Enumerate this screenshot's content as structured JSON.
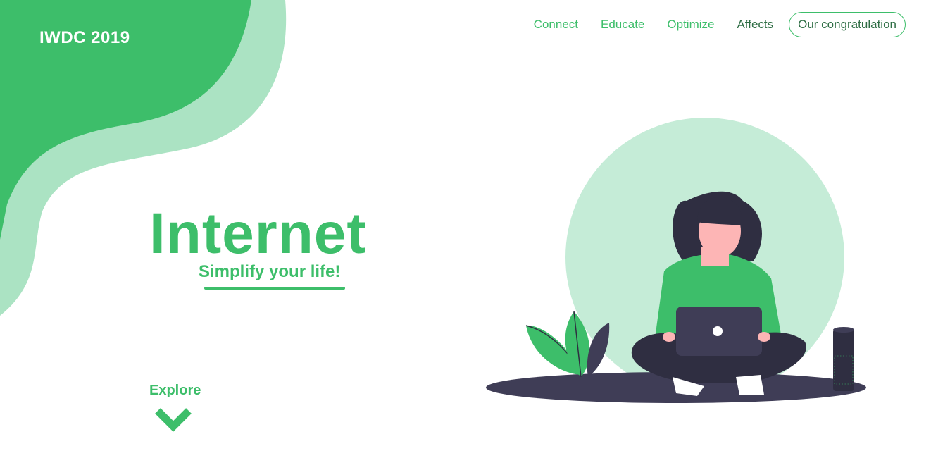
{
  "brand": {
    "logo": "IWDC 2019"
  },
  "nav": {
    "items": [
      {
        "label": "Connect"
      },
      {
        "label": "Educate"
      },
      {
        "label": "Optimize"
      },
      {
        "label": "Affects"
      }
    ],
    "cta_label": "Our congratulation"
  },
  "hero": {
    "title": "Internet",
    "subtitle": "Simplify your life!",
    "explore_label": "Explore"
  },
  "icons": {
    "explore": "chevron-down-icon",
    "illustration": "woman-with-laptop-illustration"
  },
  "colors": {
    "primary_green": "#3dbe6a",
    "light_green": "#abe3c3",
    "circle_green": "#c5ecd7",
    "dark_navy": "#2f2e41",
    "laptop": "#3f3d56",
    "skin": "#fdb5b5"
  }
}
